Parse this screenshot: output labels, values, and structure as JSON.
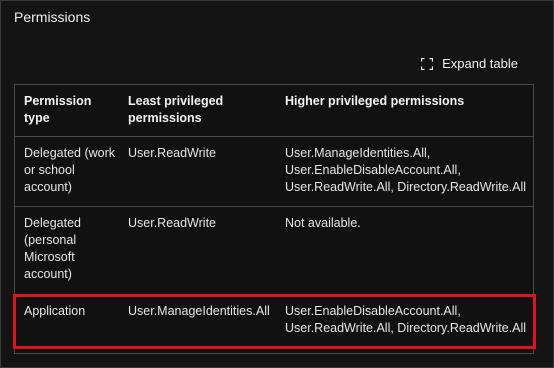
{
  "section": {
    "title": "Permissions"
  },
  "toolbar": {
    "expand_label": "Expand table",
    "expand_icon": "expand-icon"
  },
  "table": {
    "headers": [
      "Permission type",
      "Least privileged permissions",
      "Higher privileged permissions"
    ],
    "rows": [
      [
        "Delegated (work or school account)",
        "User.ReadWrite",
        "User.ManageIdentities.All, User.EnableDisableAccount.All, User.ReadWrite.All, Directory.ReadWrite.All"
      ],
      [
        "Delegated (personal Microsoft account)",
        "User.ReadWrite",
        "Not available."
      ],
      [
        "Application",
        "User.ManageIdentities.All",
        "User.EnableDisableAccount.All, User.ReadWrite.All, Directory.ReadWrite.All"
      ]
    ]
  },
  "colors": {
    "background": "#141414",
    "highlight": "#e1141e",
    "border": "#4a4a4a"
  }
}
